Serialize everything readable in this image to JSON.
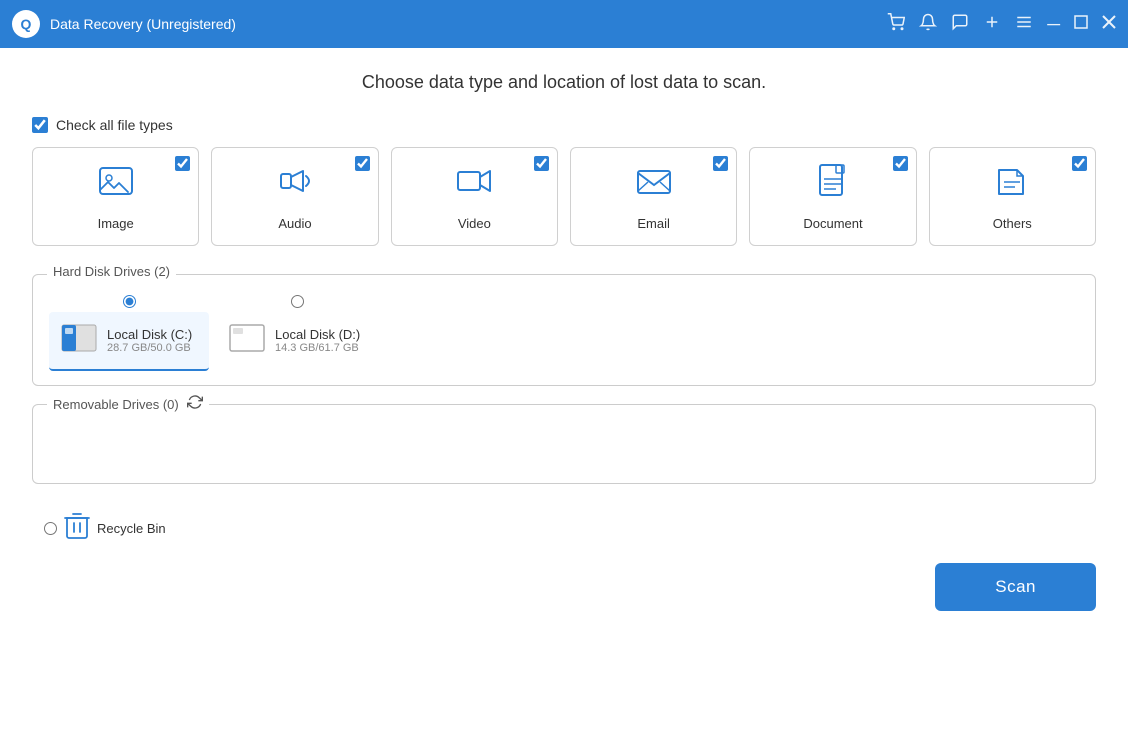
{
  "titleBar": {
    "title": "Data Recovery (Unregistered)",
    "icon": "Q",
    "controls": {
      "cart": "🛒",
      "bell": "🔔",
      "chat": "💬",
      "add": "+",
      "menu": "≡",
      "minimize": "─",
      "restore": "□",
      "close": "✕"
    }
  },
  "page": {
    "title": "Choose data type and location of lost data to scan.",
    "checkAllLabel": "Check all file types",
    "checkAllChecked": true
  },
  "fileTypes": [
    {
      "id": "image",
      "label": "Image",
      "checked": true,
      "icon": "image"
    },
    {
      "id": "audio",
      "label": "Audio",
      "checked": true,
      "icon": "audio"
    },
    {
      "id": "video",
      "label": "Video",
      "checked": true,
      "icon": "video"
    },
    {
      "id": "email",
      "label": "Email",
      "checked": true,
      "icon": "email"
    },
    {
      "id": "document",
      "label": "Document",
      "checked": true,
      "icon": "document"
    },
    {
      "id": "others",
      "label": "Others",
      "checked": true,
      "icon": "others"
    }
  ],
  "hardDiskDrives": {
    "label": "Hard Disk Drives (2)",
    "drives": [
      {
        "id": "c",
        "name": "Local Disk (C:)",
        "size": "28.7 GB/50.0 GB",
        "selected": true,
        "style": "blue"
      },
      {
        "id": "d",
        "name": "Local Disk (D:)",
        "size": "14.3 GB/61.7 GB",
        "selected": false,
        "style": "white"
      }
    ]
  },
  "removableDrives": {
    "label": "Removable Drives (0)",
    "items": []
  },
  "recycleBin": {
    "label": "Recycle Bin",
    "selected": false
  },
  "scanButton": {
    "label": "Scan"
  }
}
